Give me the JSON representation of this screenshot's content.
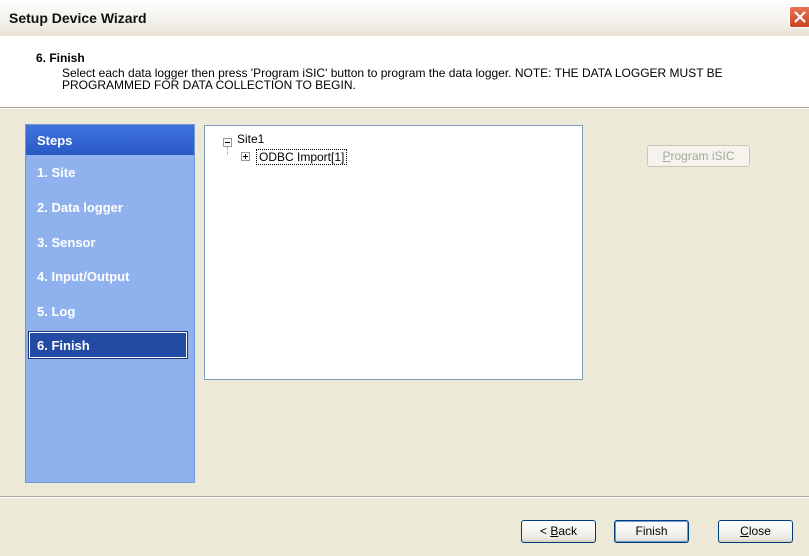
{
  "window": {
    "title": "Setup Device Wizard",
    "close_icon": "close-icon"
  },
  "header": {
    "step_title": "6. Finish",
    "description": "Select each data logger then press 'Program iSIC' button to program the data logger.  NOTE: THE DATA LOGGER MUST BE PROGRAMMED FOR DATA COLLECTION TO BEGIN."
  },
  "sidebar": {
    "heading": "Steps",
    "items": [
      {
        "label": "1. Site"
      },
      {
        "label": "2. Data logger"
      },
      {
        "label": "3. Sensor"
      },
      {
        "label": "4. Input/Output"
      },
      {
        "label": "5. Log"
      },
      {
        "label": "6. Finish",
        "active": true
      }
    ]
  },
  "tree": {
    "root": {
      "label": "Site1",
      "expanded": true
    },
    "child": {
      "label": "ODBC Import[1]",
      "expanded": false,
      "selected": true
    }
  },
  "program_button": {
    "label_pre": "",
    "label_mnemonic": "P",
    "label_post": "rogram iSIC",
    "enabled": false
  },
  "footer": {
    "back_pre": "< ",
    "back_mnemonic": "B",
    "back_post": "ack",
    "finish_label": "Finish",
    "close_mnemonic": "C",
    "close_post": "lose"
  }
}
